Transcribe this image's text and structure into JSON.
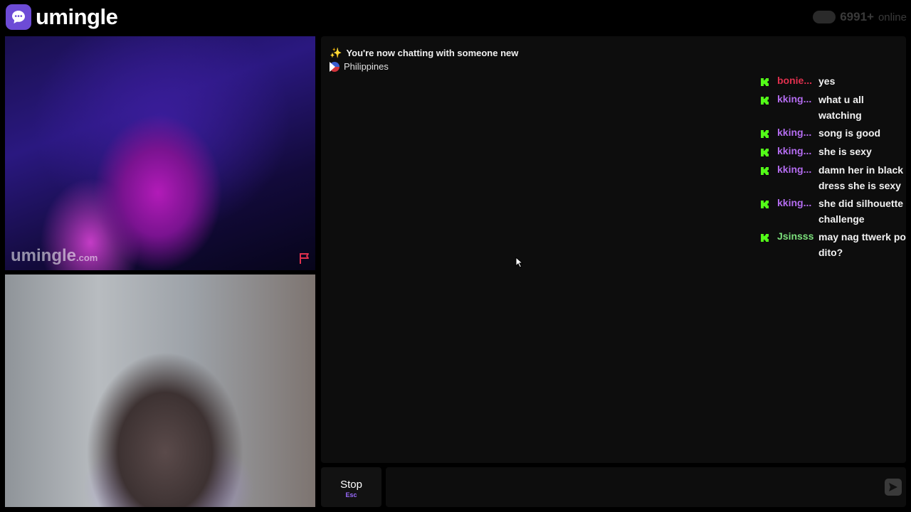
{
  "app": {
    "brand": "umingle",
    "online_count": "6991+",
    "online_label": "online"
  },
  "stranger_video": {
    "watermark_main": "umingle",
    "watermark_suffix": ".com"
  },
  "chat": {
    "notice_title": "You're now chatting with someone new",
    "notice_country": "Philippines",
    "messages": [
      {
        "user": "bonie...",
        "user_color": "#e0304e",
        "text": "yes"
      },
      {
        "user": "kking...",
        "user_color": "#b46cf0",
        "text": "what u all watching"
      },
      {
        "user": "kking...",
        "user_color": "#b46cf0",
        "text": "song is good"
      },
      {
        "user": "kking...",
        "user_color": "#b46cf0",
        "text": "she is sexy"
      },
      {
        "user": "kking...",
        "user_color": "#b46cf0",
        "text": "damn her in black dress she is sexy"
      },
      {
        "user": "kking...",
        "user_color": "#b46cf0",
        "text": "she did silhouette challenge"
      },
      {
        "user": "Jsinsss",
        "user_color": "#7be07b",
        "text": "may nag ttwerk po dito?"
      }
    ]
  },
  "controls": {
    "stop_label": "Stop",
    "stop_hint": "Esc",
    "message_value": "",
    "message_placeholder": ""
  },
  "icons": {
    "logo": "chat-bubble-icon",
    "flag": "report-flag-icon",
    "kick": "kick-icon",
    "send": "send-icon",
    "sparkle": "sparkles-icon"
  },
  "colors": {
    "brand": "#6d4bd6",
    "kick_green": "#53fc18",
    "stop_hint": "#9b6bff",
    "report_flag": "#e0304e"
  }
}
